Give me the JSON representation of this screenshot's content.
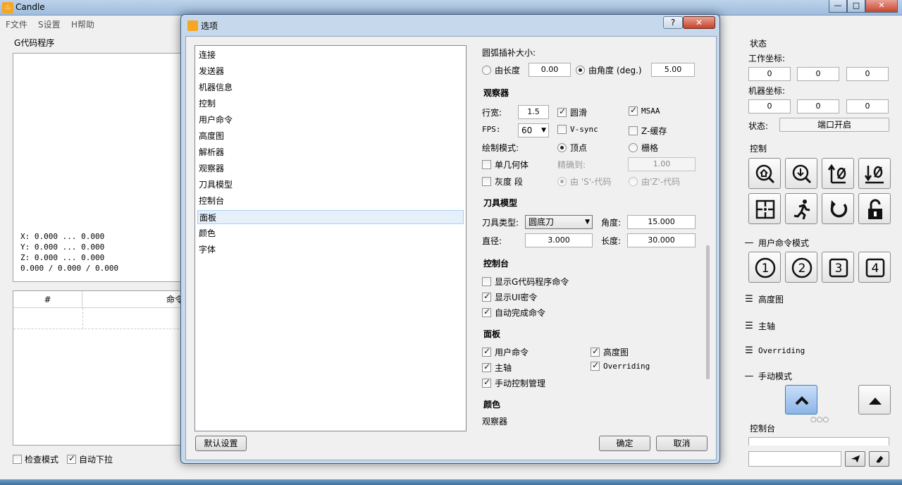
{
  "app": {
    "title": "Candle",
    "icon": "candle-app-icon"
  },
  "window_controls": {
    "minimize": "—",
    "maximize": "□",
    "close": "✕"
  },
  "menu": [
    {
      "label": "F文件"
    },
    {
      "label": "S设置"
    },
    {
      "label": "H帮助"
    }
  ],
  "left": {
    "gcode_title": "G代码程序",
    "coords": [
      "X: 0.000 ... 0.000",
      "Y: 0.000 ... 0.000",
      "Z: 0.000 ... 0.000",
      "0.000 / 0.000 / 0.000"
    ],
    "table_headers": [
      "#",
      "命令"
    ],
    "check_mode": {
      "label": "检查模式",
      "checked": false
    },
    "auto_scroll": {
      "label": "自动下拉",
      "checked": true
    }
  },
  "right": {
    "status_title": "状态",
    "work_coords_label": "工作坐标:",
    "work_coords": [
      "0",
      "0",
      "0"
    ],
    "machine_coords_label": "机器坐标:",
    "machine_coords": [
      "0",
      "0",
      "0"
    ],
    "state_label": "状态:",
    "state_value": "端口开启",
    "control_title": "控制",
    "user_cmd_title": "用户命令模式",
    "user_cmd_buttons": [
      "1",
      "2",
      "3",
      "4"
    ],
    "heightmap_title": "高度图",
    "spindle_title": "主轴",
    "overriding_title": "Overriding",
    "jog_title": "手动模式",
    "console_title": "控制台"
  },
  "dialog": {
    "title": "选项",
    "help": "?",
    "close": "✕",
    "categories": [
      "连接",
      "发送器",
      "机器信息",
      "控制",
      "用户命令",
      "高度图",
      "解析器",
      "观察器",
      "刀具模型",
      "控制台",
      "面板",
      "颜色",
      "字体"
    ],
    "selected_category": "面板",
    "arc": {
      "title": "圆弧插补大小:",
      "by_length_label": "由长度",
      "by_length_value": "0.00",
      "by_angle_label": "由角度 (deg.)",
      "by_angle_value": "5.00",
      "selected": "angle"
    },
    "viewer": {
      "title": "观察器",
      "line_width_label": "行宽:",
      "line_width": "1.5",
      "smooth_label": "圆滑",
      "smooth": true,
      "msaa_label": "MSAA",
      "msaa": true,
      "fps_label": "FPS:",
      "fps": "60",
      "vsync_label": "V-sync",
      "vsync": false,
      "zbuffer_label": "Z-缓存",
      "zbuffer": false,
      "draw_mode_label": "绘制模式:",
      "vertex_label": "顶点",
      "raster_label": "栅格",
      "draw_mode": "vertex",
      "simple_geom_label": "单几何体",
      "simple_geom": false,
      "precision_label": "精确到:",
      "precision": "1.00",
      "grayscale_label": "灰度 段",
      "grayscale": false,
      "by_s_label": "由 'S'-代码",
      "by_z_label": "由'Z'-代码"
    },
    "tool": {
      "title": "刀具模型",
      "type_label": "刀具类型:",
      "type": "圆底刀",
      "angle_label": "角度:",
      "angle": "15.000",
      "diameter_label": "直径:",
      "diameter": "3.000",
      "length_label": "长度:",
      "length": "30.000"
    },
    "console": {
      "title": "控制台",
      "show_program_label": "显示G代码程序命令",
      "show_program": false,
      "show_ui_label": "显示UI密令",
      "show_ui": true,
      "autocomplete_label": "自动完成命令",
      "autocomplete": true
    },
    "panels": {
      "title": "面板",
      "user_cmd_label": "用户命令",
      "user_cmd": true,
      "heightmap_label": "高度图",
      "heightmap": true,
      "spindle_label": "主轴",
      "spindle": true,
      "overriding_label": "Overriding",
      "overriding": true,
      "jog_label": "手动控制管理",
      "jog": true
    },
    "colors": {
      "title": "颜色",
      "viewer_label": "观察器"
    },
    "default_button": "默认设置",
    "ok_button": "确定",
    "cancel_button": "取消"
  }
}
